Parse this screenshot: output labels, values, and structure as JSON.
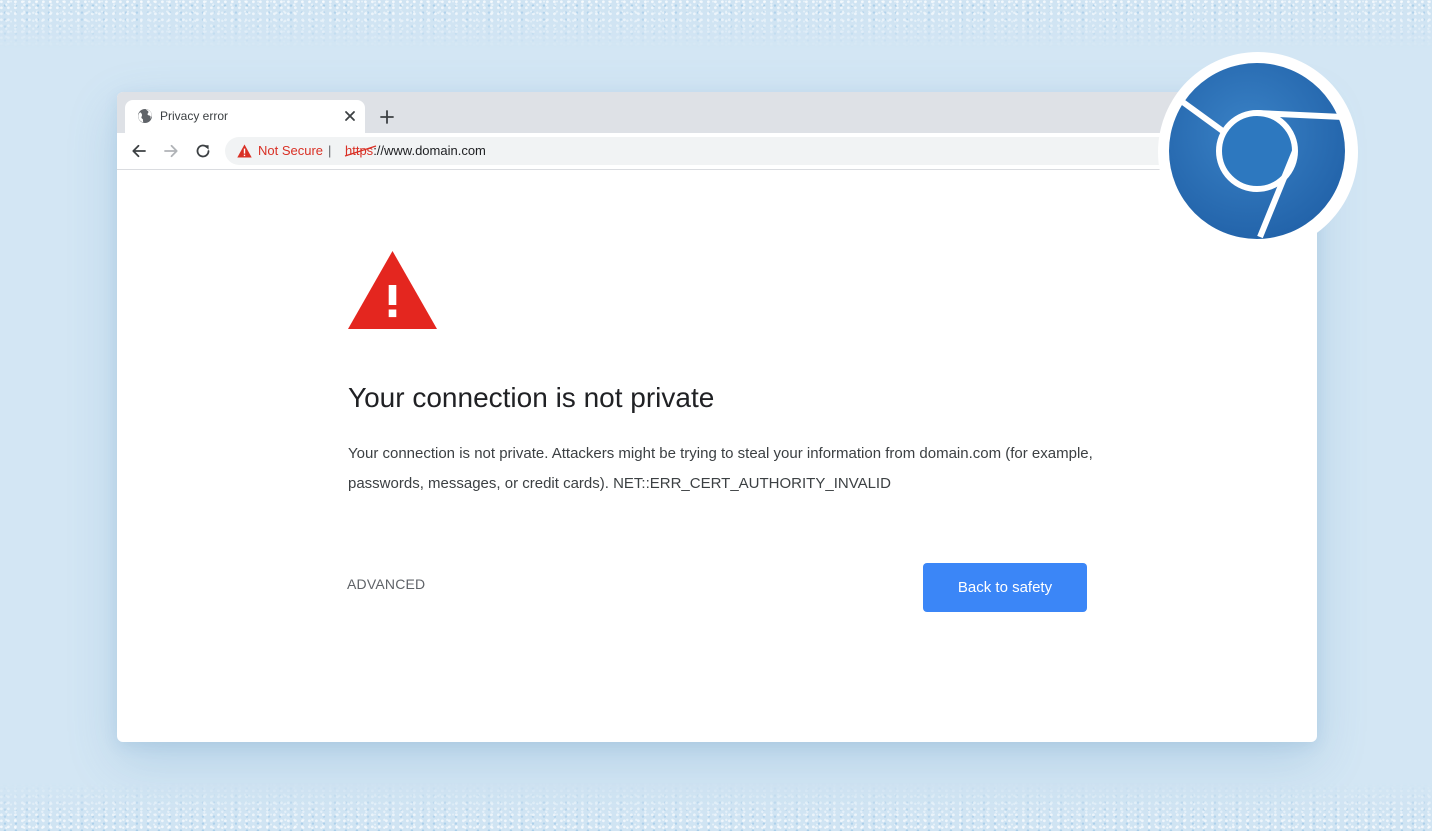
{
  "tab": {
    "title": "Privacy error",
    "favicon": "globe-icon",
    "close_icon": "close-icon",
    "new_tab_icon": "plus-icon"
  },
  "toolbar": {
    "back_icon": "arrow-left-icon",
    "forward_icon": "arrow-right-icon",
    "reload_icon": "reload-icon",
    "security_label": "Not Secure",
    "separator": "|",
    "url_scheme": "https",
    "url_rest": "://www.domain.com"
  },
  "page": {
    "heading": "Your connection is not private",
    "body": "Your connection is not private. Attackers might be trying to steal your information from domain.com (for example, passwords, messages, or credit cards). NET::ERR_CERT_AUTHORITY_INVALID",
    "advanced_label": "ADVANCED",
    "primary_button_label": "Back to safety",
    "warning_icon": "warning-triangle-icon"
  },
  "badge": {
    "icon": "chrome-logo-icon"
  },
  "colors": {
    "background": "#d3e6f4",
    "warning_red": "#e4261f",
    "not_secure_red": "#d93025",
    "primary_blue": "#3b86f7",
    "logo_blue": "#2e6fb5"
  }
}
